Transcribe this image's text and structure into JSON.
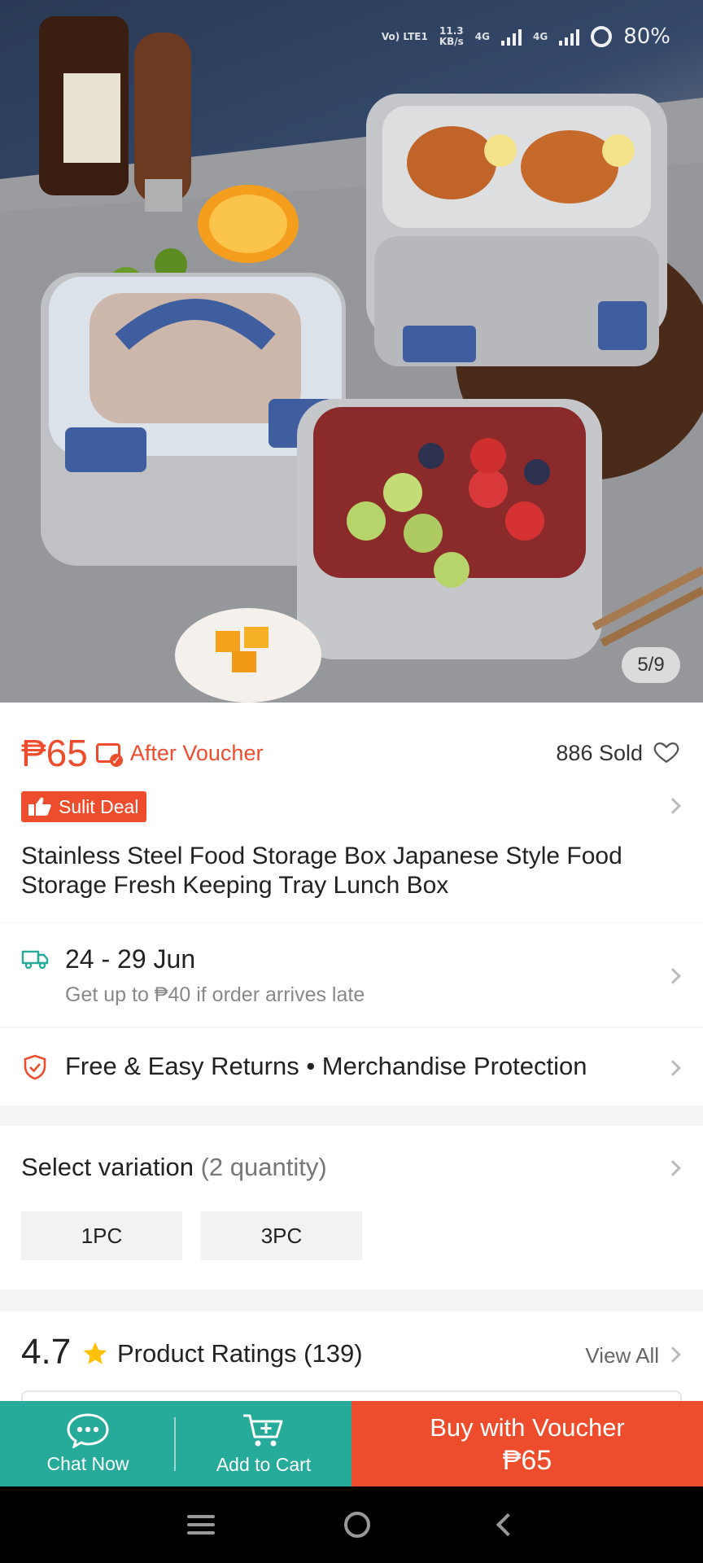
{
  "status_bar": {
    "network_label": "Vo) LTE1",
    "speed_value": "11.3",
    "speed_unit": "KB/s",
    "signal_1": "4G",
    "signal_2": "4G",
    "battery": "80%"
  },
  "hero": {
    "image_counter": "5/9"
  },
  "price": {
    "value": "₱65",
    "after_voucher": "After Voucher",
    "sold": "886 Sold"
  },
  "badge": {
    "label": "Sulit Deal"
  },
  "product": {
    "title": "Stainless Steel Food Storage Box Japanese Style Food Storage Fresh Keeping Tray Lunch Box"
  },
  "shipping": {
    "date_range": "24 - 29 Jun",
    "late_guarantee": "Get up to ₱40 if order arrives late"
  },
  "returns": {
    "text": "Free & Easy Returns  •  Merchandise Protection"
  },
  "variation": {
    "title": "Select variation",
    "quantity": "(2 quantity)",
    "options": [
      "1PC",
      "3PC"
    ]
  },
  "ratings": {
    "score": "4.7",
    "label": "Product Ratings (139)",
    "view_all": "View All"
  },
  "actions": {
    "chat": "Chat Now",
    "cart": "Add to Cart",
    "buy_line1": "Buy with Voucher",
    "buy_price": "₱65"
  },
  "colors": {
    "brand_orange": "#ee4d2d",
    "action_green": "#26aa99",
    "rating_star": "#ffc107"
  }
}
